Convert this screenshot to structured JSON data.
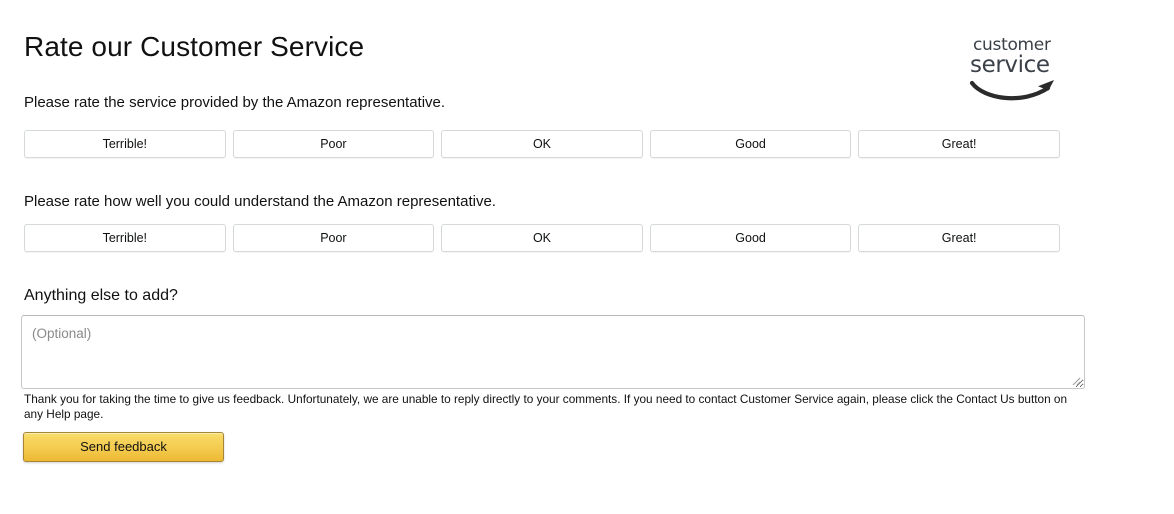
{
  "header": {
    "title": "Rate our Customer Service",
    "logo": {
      "word_top": "customer",
      "word_bottom": "service",
      "smile_icon_name": "amazon-smile-arrow-icon"
    }
  },
  "questions": {
    "service_quality": "Please rate the service provided by the Amazon representative.",
    "understandability": "Please rate how well you could understand the Amazon representative.",
    "additional_comments": "Anything else to add?"
  },
  "rating_options": [
    "Terrible!",
    "Poor",
    "OK",
    "Good",
    "Great!"
  ],
  "comment": {
    "placeholder": "(Optional)",
    "value": ""
  },
  "disclaimer": "Thank you for taking the time to give us feedback. Unfortunately, we are unable to reply directly to your comments. If you need to contact Customer Service again, please click the Contact Us button on any Help page.",
  "submit": {
    "label": "Send feedback"
  },
  "colors": {
    "page_background": "#ffffff",
    "text": "#111111",
    "button_border": "#d5d9d9",
    "submit_gradient_top": "#f8e071",
    "submit_gradient_bottom": "#eeb933",
    "submit_border": "#a88734",
    "placeholder_text": "#8a8a8a",
    "logo_gray": "#3b4148"
  }
}
